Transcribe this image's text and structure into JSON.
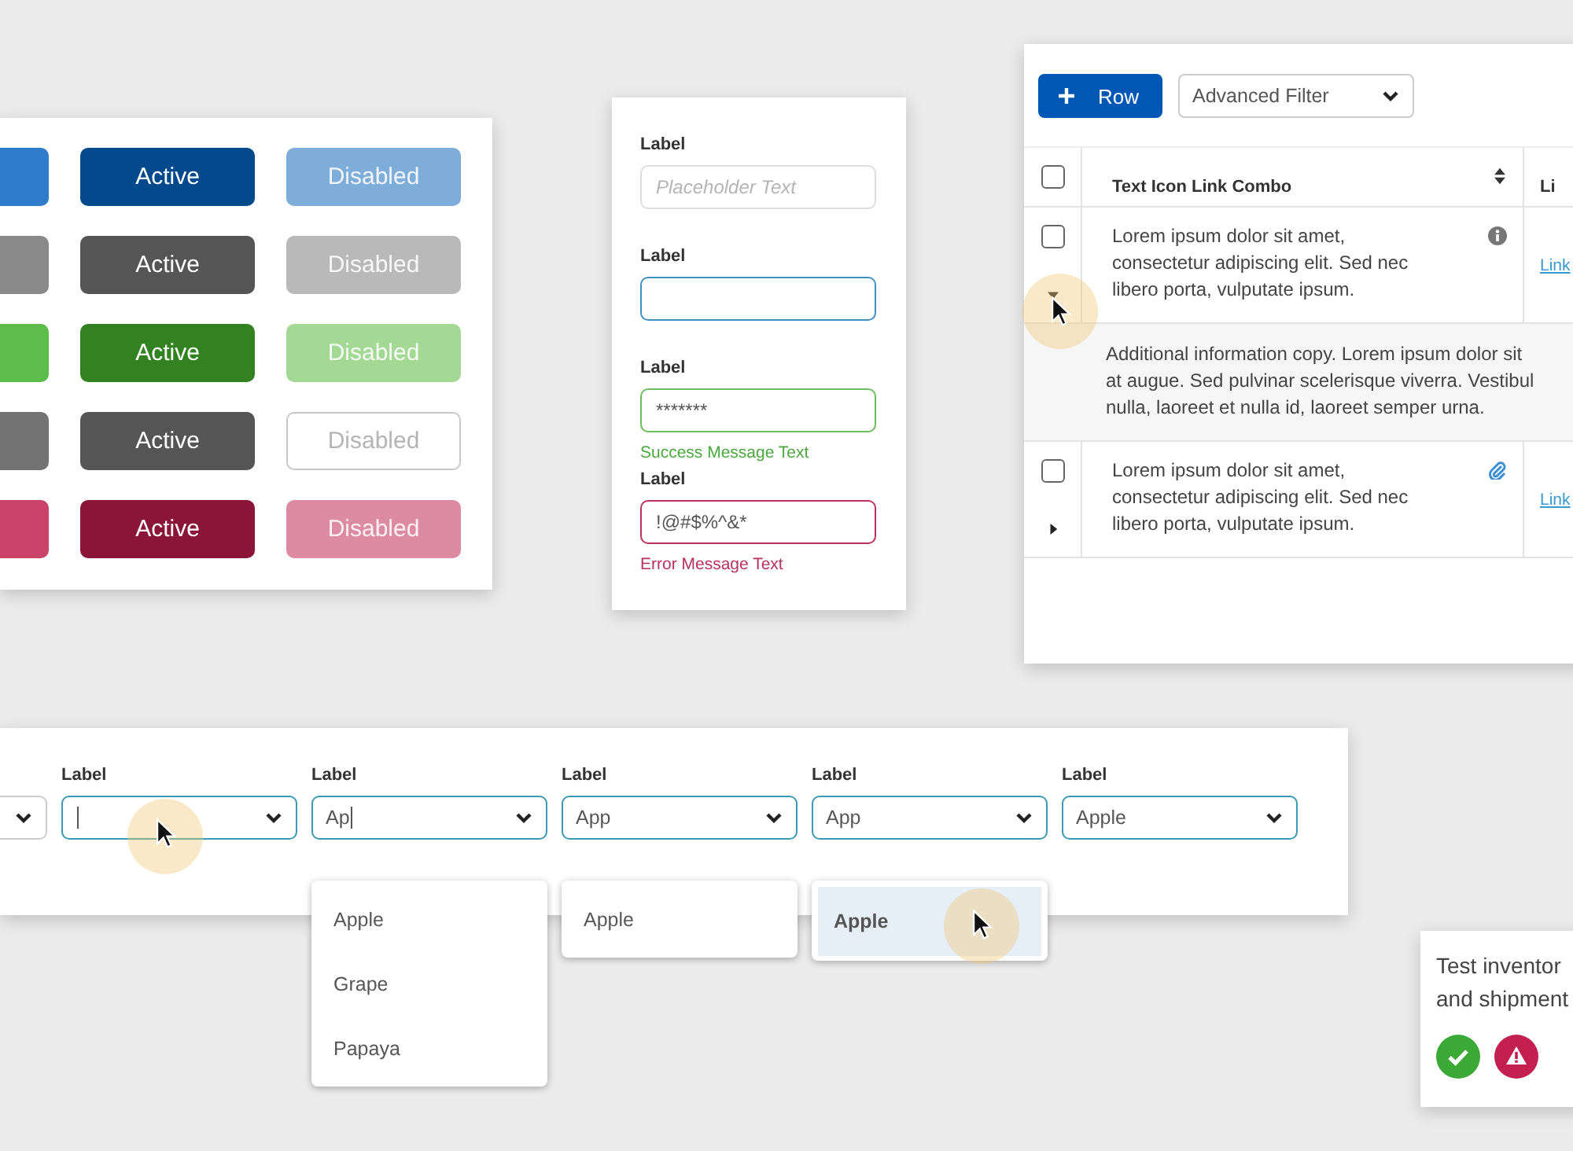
{
  "button_panel": {
    "rows": [
      {
        "buttons": [
          {
            "kind": "default",
            "color": "#2f7ccb"
          },
          {
            "kind": "active",
            "label": "Active",
            "color": "#024a8b"
          },
          {
            "kind": "disabled",
            "label": "Disabled",
            "color": "#7fadd9"
          }
        ]
      },
      {
        "buttons": [
          {
            "kind": "default",
            "color": "#8a8a8a"
          },
          {
            "kind": "active",
            "label": "Active",
            "color": "#555555"
          },
          {
            "kind": "disabled",
            "label": "Disabled",
            "color": "#b9b9b9"
          }
        ]
      },
      {
        "buttons": [
          {
            "kind": "default",
            "color": "#5cbd4b"
          },
          {
            "kind": "active",
            "label": "Active",
            "color": "#338222"
          },
          {
            "kind": "disabled",
            "label": "Disabled",
            "color": "#a3d895"
          }
        ]
      },
      {
        "buttons": [
          {
            "kind": "default",
            "color": "#737373"
          },
          {
            "kind": "active",
            "label": "Active",
            "color": "#555555"
          },
          {
            "kind": "outline",
            "label": "Disabled",
            "color": "#ffffff"
          }
        ]
      },
      {
        "buttons": [
          {
            "kind": "default",
            "color": "#c9436a"
          },
          {
            "kind": "active",
            "label": "Active",
            "color": "#8b1538"
          },
          {
            "kind": "disabled",
            "label": "Disabled",
            "color": "#dd8aa3"
          }
        ]
      }
    ]
  },
  "form": {
    "fields": [
      {
        "label": "Label",
        "kind": "default",
        "placeholder": "Placeholder Text"
      },
      {
        "label": "Label",
        "kind": "focus"
      },
      {
        "label": "Label",
        "kind": "success",
        "value": "*******",
        "message": "Success Message Text"
      },
      {
        "label": "Label",
        "kind": "error",
        "value": "!@#$%^&*",
        "message": "Error Message Text"
      }
    ]
  },
  "table": {
    "add_button": "Row",
    "filter": "Advanced Filter",
    "header_checked": false,
    "columns": [
      "Text Icon Link Combo",
      "Li"
    ],
    "rows": [
      {
        "checked": false,
        "expanded": true,
        "text": "Lorem ipsum dolor sit amet, consectetur adipiscing elit. Sed nec libero porta, vulputate ipsum.",
        "kind": "info",
        "link": "Link",
        "details": [
          "Additional information copy. Lorem ipsum dolor sit",
          "at augue. Sed pulvinar scelerisque viverra. Vestibul",
          "nulla, laoreet et nulla id, laoreet semper urna."
        ]
      },
      {
        "checked": false,
        "expanded": false,
        "text": "Lorem ipsum dolor sit amet, consectetur adipiscing elit. Sed nec libero porta, vulputate ipsum.",
        "kind": "attachment",
        "link": "Link"
      }
    ]
  },
  "dropdowns": [
    {
      "kind": "default"
    },
    {
      "kind": "focus",
      "label": "Label",
      "typing": true
    },
    {
      "kind": "focus",
      "label": "Label",
      "value": "Ap",
      "typing": true,
      "menu": [
        {
          "label": "Apple",
          "selected": false
        },
        {
          "label": "Grape",
          "selected": false
        },
        {
          "label": "Papaya",
          "selected": false
        }
      ]
    },
    {
      "kind": "focus",
      "label": "Label",
      "value": "App",
      "menu": [
        {
          "label": "Apple",
          "selected": false
        }
      ]
    },
    {
      "kind": "focus",
      "label": "Label",
      "value": "App",
      "menu": [
        {
          "label": "Apple",
          "selected": true
        }
      ]
    },
    {
      "kind": "focus",
      "label": "Label",
      "value": "Apple"
    }
  ],
  "notification": {
    "lines": [
      "Test inventor",
      "and shipment"
    ],
    "icons": [
      {
        "kind": "success"
      },
      {
        "kind": "warning"
      }
    ]
  }
}
